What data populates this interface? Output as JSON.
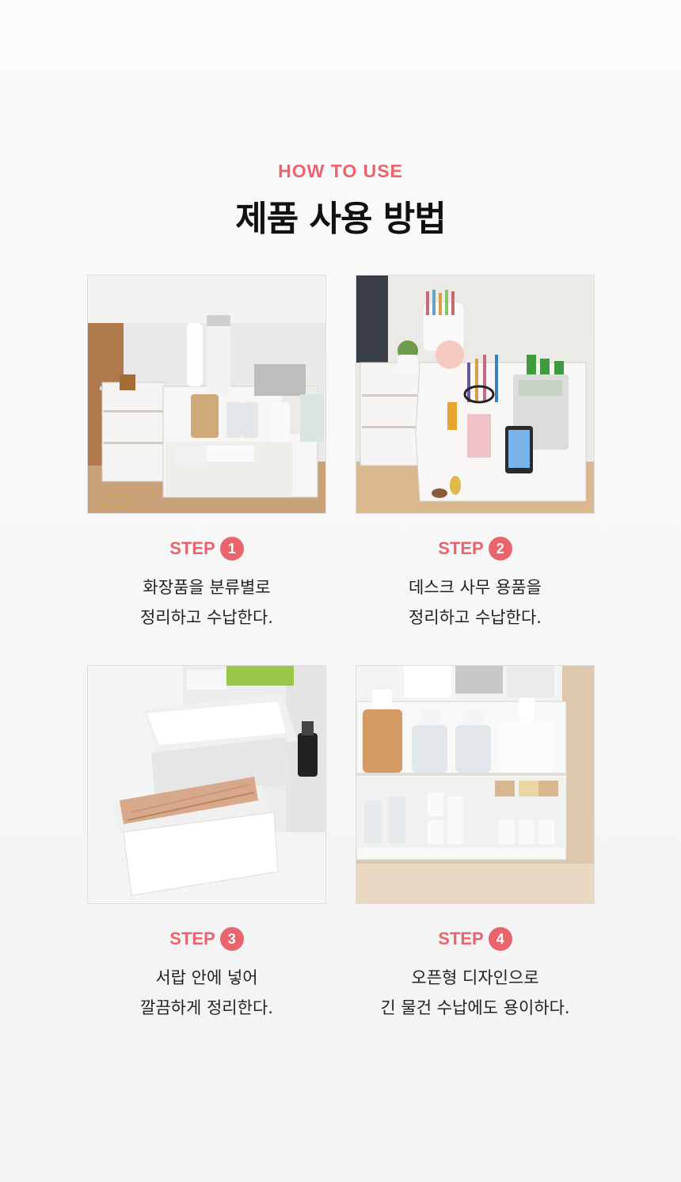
{
  "header": {
    "eyebrow": "HOW TO USE",
    "title": "제품 사용 방법"
  },
  "steps": [
    {
      "label": "STEP",
      "number": "1",
      "line1": "화장품을 분류별로",
      "line2": "정리하고 수납한다.",
      "image": "cosmetics-organizer-with-drawers-photo"
    },
    {
      "label": "STEP",
      "number": "2",
      "line1": "데스크 사무 용품을",
      "line2": "정리하고 수납한다.",
      "image": "desk-stationery-organizer-photo"
    },
    {
      "label": "STEP",
      "number": "3",
      "line1": "서랍 안에 넣어",
      "line2": "깔끔하게 정리한다.",
      "image": "open-drawers-cotton-swabs-photo"
    },
    {
      "label": "STEP",
      "number": "4",
      "line1": "오픈형 디자인으로",
      "line2": "긴 물건 수납에도 용이하다.",
      "image": "open-top-cosmetic-bottles-photo"
    }
  ],
  "colors": {
    "accent": "#e9646c",
    "title": "#111111",
    "body_text": "#222222"
  }
}
